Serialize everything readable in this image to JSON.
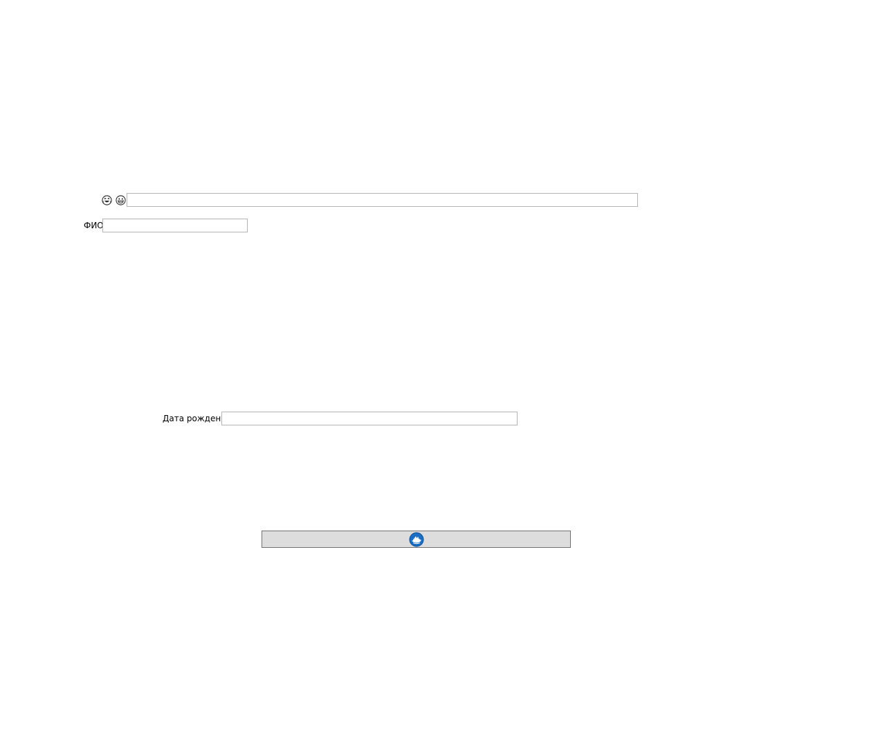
{
  "emoji_row": {
    "icons": [
      "grinning-squint-tears-face-icon",
      "grinning-face-icon"
    ],
    "input_value": "",
    "input_placeholder": ""
  },
  "fio": {
    "label": "ФИО",
    "value": "",
    "placeholder": ""
  },
  "birth_date": {
    "label": "Дата рождения",
    "value": "",
    "placeholder": ""
  },
  "submit_button": {
    "label": "",
    "icon": "blue-logo-icon",
    "accent_color": "#1a6fc4"
  }
}
